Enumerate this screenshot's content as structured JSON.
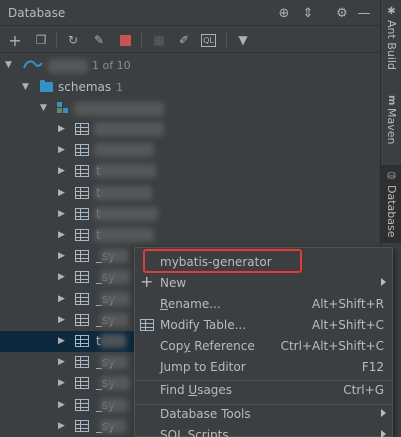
{
  "titlebar": {
    "title": "Database",
    "icons": [
      "crosshair-icon",
      "collapse-icon",
      "gear-icon",
      "hide-icon"
    ]
  },
  "toolbar": {
    "icons": [
      "add-icon",
      "copy-icon",
      "refresh-icon",
      "properties-icon",
      "stop-icon",
      "table-icon",
      "edit-icon",
      "sql-icon",
      "filter-icon"
    ]
  },
  "tree": {
    "connection_count": "1 of 10",
    "schemas_label": "schemas",
    "schemas_count": "1",
    "table_rows": [
      {
        "visible_text": ""
      },
      {
        "visible_text": ""
      },
      {
        "visible_text": "t"
      },
      {
        "visible_text": "t"
      },
      {
        "visible_text": "t"
      },
      {
        "visible_text": "t"
      },
      {
        "visible_text": "_sy"
      },
      {
        "visible_text": "_sy"
      },
      {
        "visible_text": "_sy"
      },
      {
        "visible_text": "_sy"
      },
      {
        "visible_text": "t"
      },
      {
        "visible_text": "_sy"
      },
      {
        "visible_text": "_sy"
      },
      {
        "visible_text": "_sy"
      },
      {
        "visible_text": "_sy"
      }
    ],
    "selected_row_text": "t"
  },
  "stripe": {
    "ant_build": "Ant Build",
    "maven": "Maven",
    "database": "Database"
  },
  "menu": {
    "items": [
      {
        "label": "mybatis-generator",
        "shortcut": "",
        "submenu": false
      },
      {
        "label": "New",
        "shortcut": "",
        "submenu": true
      },
      {
        "label": "Rename...",
        "shortcut": "Alt+Shift+R",
        "submenu": false
      },
      {
        "label": "Modify Table...",
        "shortcut": "Alt+Shift+C",
        "submenu": false
      },
      {
        "label": "Copy Reference",
        "shortcut": "Ctrl+Alt+Shift+C",
        "submenu": false
      },
      {
        "label": "Jump to Editor",
        "shortcut": "F12",
        "submenu": false
      },
      {
        "label": "Find Usages",
        "shortcut": "Ctrl+G",
        "submenu": false
      },
      {
        "label": "Database Tools",
        "shortcut": "",
        "submenu": true
      },
      {
        "label": "SQL Scripts",
        "shortcut": "",
        "submenu": true
      }
    ]
  },
  "colors": {
    "background": "#3c3f41",
    "selection": "#0d293e",
    "highlight": "#e53935",
    "accent": "#3592c4"
  }
}
